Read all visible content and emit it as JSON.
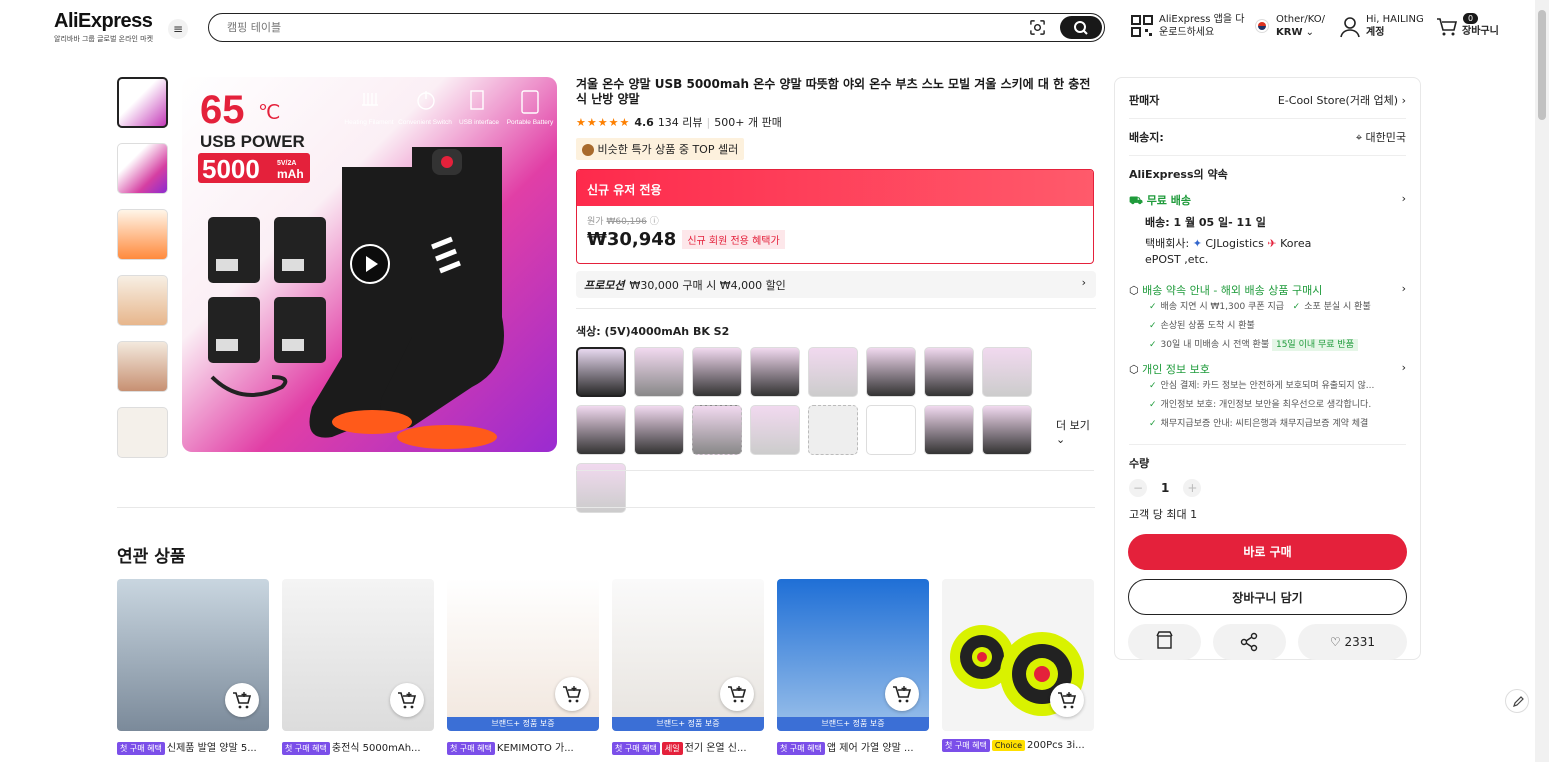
{
  "header": {
    "logo": "AliExpress",
    "logo_sub": "알리바바 그룹 글로벌 온라인 마켓",
    "search_placeholder": "캠핑 테이블",
    "app_line1": "AliExpress 앱을 다",
    "app_line2": "운로드하세요",
    "locale_line1": "Other/KO/",
    "locale_line2": "KRW",
    "account_line1": "Hi, HAILING",
    "account_line2": "계정",
    "cart_count": "0",
    "cart_label": "장바구니"
  },
  "product": {
    "title": "겨울 온수 양말 USB 5000mah 온수 양말 따뜻함 야외 온수 부츠 스노 모빌 겨울 스키에 대 한 충전식 난방 양말",
    "rating": "4.6",
    "reviews": "134 리뷰",
    "sold": "500+ 개 판매",
    "badge": "비슷한 특가 상품 중 TOP 셀러",
    "price_header": "신규 유저 전용",
    "orig_label": "원가",
    "orig_price": "₩60,196",
    "price": "₩30,948",
    "price_tag": "신규 회원 전용 혜택가",
    "promo_label": "프로모션",
    "promo_text": "₩30,000 구매 시 ₩4,000 할인",
    "color_label": "색상: (5V)4000mAh BK S2",
    "more_label": "더 보기",
    "image_text": {
      "temp": "65",
      "temp_unit": "℃",
      "usb_power": "USB POWER",
      "capacity": "5000",
      "capacity_unit": "mAh",
      "capacity_spec": "5V/2A",
      "feat1": "Heating Filament",
      "feat2": "Convenient Switch",
      "feat3": "USB interface",
      "feat4": "Portable Battery"
    }
  },
  "side": {
    "seller_label": "판매자",
    "seller_name": "E-Cool Store(거래 업체)",
    "ship_to_label": "배송지:",
    "ship_to": "대한민국",
    "promise_title": "AliExpress의 약속",
    "free_ship": "무료 배송",
    "delivery": "배송: 1 월 05 일- 11 일",
    "carrier_label": "택배회사:",
    "carrier1": "CJLogistics",
    "carrier2": "Korea",
    "carrier3": "ePOST ,etc.",
    "guide_title": "배송 약속 안내 - 해외 배송 상품 구매시",
    "guide1": "배송 지연 시 ₩1,300 쿠폰 지급",
    "guide2": "소포 분실 시 환불",
    "guide3": "손상된 상품 도착 시 환불",
    "guide4": "30일 내 미배송 시 전액 환불",
    "guide4_tag": "15일 이내 무료 반품",
    "privacy_title": "개인 정보 보호",
    "privacy1": "안심 결제: 카드 정보는 안전하게 보호되며 유출되지 않...",
    "privacy2": "개인정보 보호: 개인정보 보안을 최우선으로 생각합니다.",
    "privacy3": "채무지급보증 안내: 씨티은행과 채무지급보증 계약 체결",
    "qty_label": "수량",
    "qty": "1",
    "max_label": "고객 당 최대 1",
    "buy_now": "바로 구매",
    "add_cart": "장바구니 담기",
    "wish_count": "2331"
  },
  "related": {
    "title": "연관 상품",
    "first_buy": "첫 구매 혜택",
    "brand_badge": "브랜드+ 정품 보증",
    "sale": "세일",
    "choice": "Choice",
    "items": [
      "신제품 발열 양말 5...",
      "충전식 5000mAh...",
      "KEMIMOTO 가...",
      "전기 온열 신...",
      "앱 제어 가열 양말 ...",
      "200Pcs 3i..."
    ]
  }
}
